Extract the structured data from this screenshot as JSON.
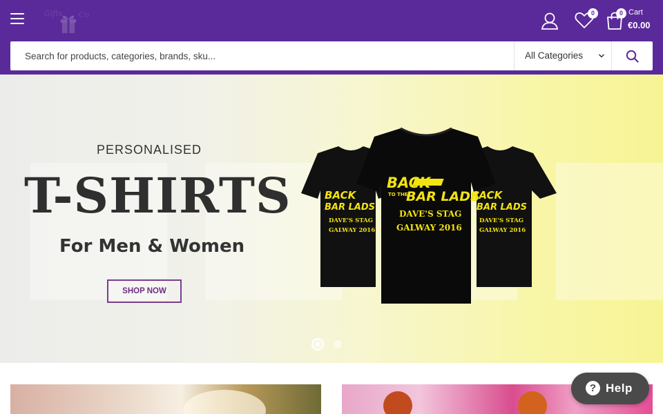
{
  "header": {
    "menu_icon": "hamburger-menu-icon",
    "logo_icon": "gift-box-logo",
    "account_icon": "user-icon",
    "wishlist": {
      "icon": "heart-icon",
      "count": "0"
    },
    "cart": {
      "icon": "shopping-bag-icon",
      "count": "0",
      "label": "Cart",
      "total": "€0.00"
    }
  },
  "search": {
    "placeholder": "Search for products, categories, brands, sku...",
    "category": "All Categories",
    "button_icon": "search-icon"
  },
  "hero": {
    "kicker": "PERSONALISED",
    "title": "T-SHIRTS",
    "subtitle": "For Men & Women",
    "button_label": "SHOP NOW",
    "shirt_text_line1": "BACK",
    "shirt_text_line2": "TO THE",
    "shirt_text_line3": "BAR LADS",
    "shirt_text_line4": "DAVE'S STAG",
    "shirt_text_line5": "GALWAY 2016",
    "slides": 2,
    "active_slide": 1
  },
  "help_widget": {
    "icon": "question-mark-icon",
    "label": "Help"
  },
  "colors": {
    "brand": "#5b2a9a",
    "button_border": "#7a3d8c",
    "shirt_print": "#f2e313",
    "help_bg": "#4a4a4a"
  }
}
